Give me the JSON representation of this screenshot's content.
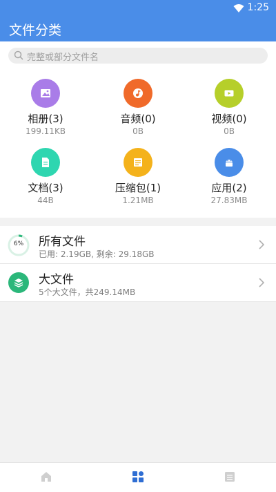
{
  "status": {
    "time": "1:25"
  },
  "appbar": {
    "title": "文件分类"
  },
  "search": {
    "placeholder": "完整或部分文件名"
  },
  "categories": [
    {
      "name": "相册(3)",
      "size": "199.11KB",
      "color": "#a97ce8",
      "icon": "image-icon"
    },
    {
      "name": "音频(0)",
      "size": "0B",
      "color": "#f06a2a",
      "icon": "music-icon"
    },
    {
      "name": "视频(0)",
      "size": "0B",
      "color": "#b6cf2a",
      "icon": "video-icon"
    },
    {
      "name": "文档(3)",
      "size": "44B",
      "color": "#2ed6b0",
      "icon": "document-icon"
    },
    {
      "name": "压缩包(1)",
      "size": "1.21MB",
      "color": "#f4b21b",
      "icon": "archive-icon"
    },
    {
      "name": "应用(2)",
      "size": "27.83MB",
      "color": "#4a8de8",
      "icon": "android-icon"
    }
  ],
  "list": {
    "all_files": {
      "title": "所有文件",
      "sub": "已用: 2.19GB, 剩余: 29.18GB",
      "percent_text": "6%",
      "percent": 6
    },
    "large_files": {
      "title": "大文件",
      "sub": "5个大文件，共249.14MB"
    }
  },
  "bottom_nav": [
    "home-icon",
    "grid-icon",
    "list-icon"
  ],
  "colors": {
    "accent": "#4a8de8",
    "active_tab": "#2f6ed3",
    "inactive_tab": "#c8c8c8",
    "progress": "#2bb77a"
  }
}
